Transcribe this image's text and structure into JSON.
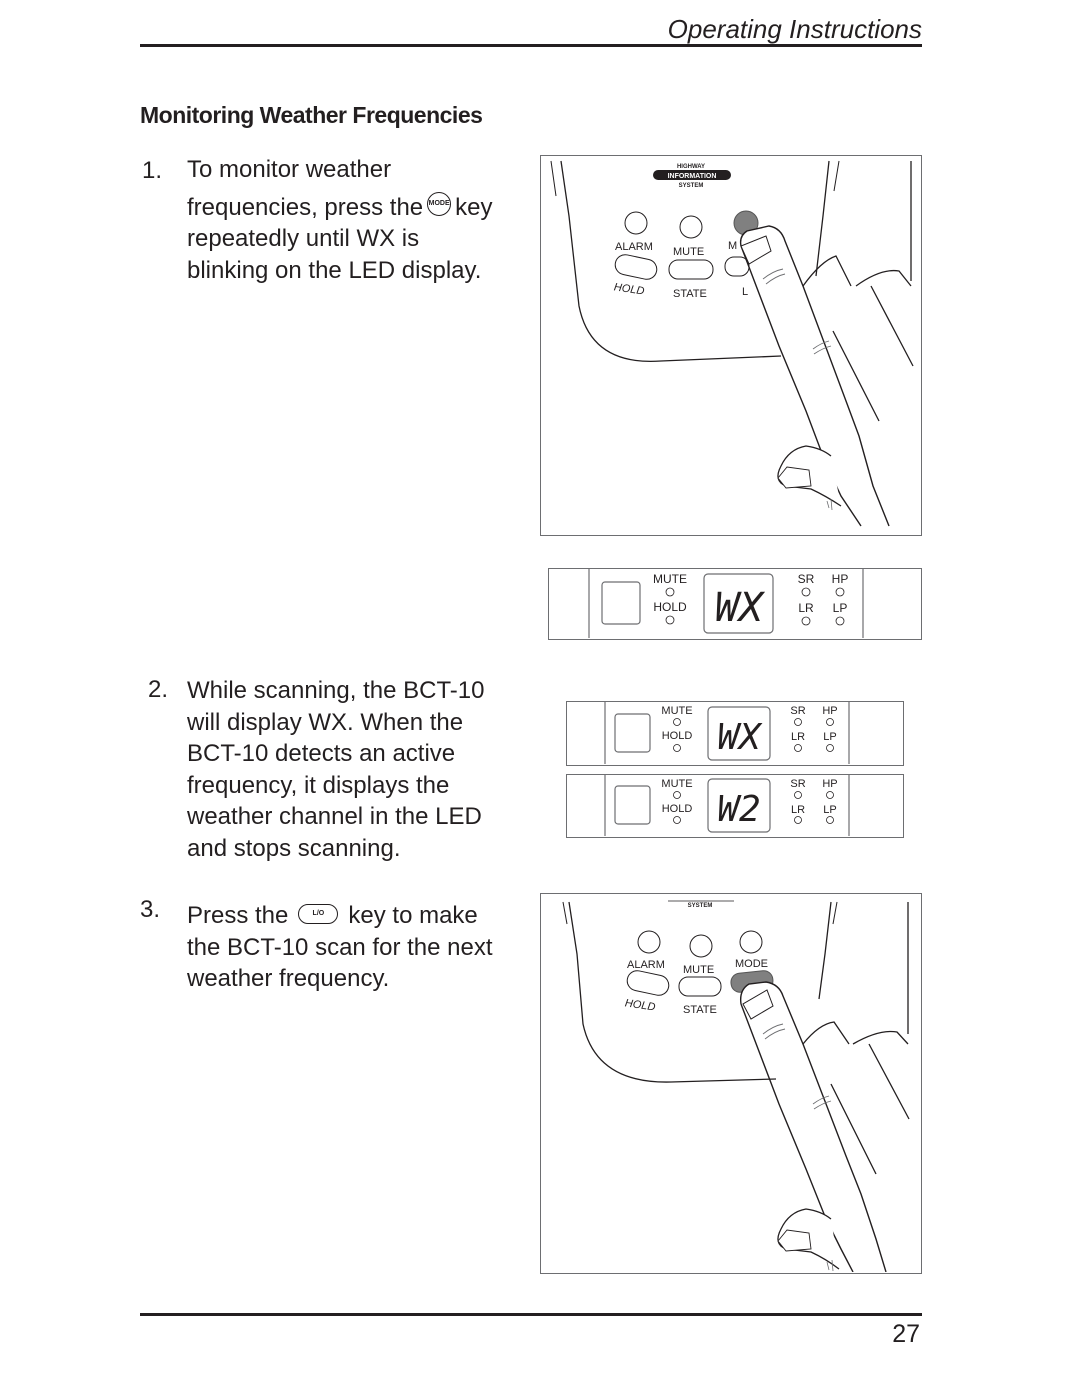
{
  "header": {
    "title": "Operating Instructions"
  },
  "section": {
    "title": "Monitoring Weather Frequencies"
  },
  "steps": [
    {
      "number": "1.",
      "lines": [
        "To monitor weather",
        "frequencies, press the",
        "key",
        "repeatedly until WX is",
        "blinking on the LED display."
      ],
      "key_label": "MODE",
      "key_icon": "mode-key-icon"
    },
    {
      "number": "2.",
      "lines": [
        "While scanning, the BCT-10",
        "will display WX. When the",
        "BCT-10 detects an active",
        "frequency, it displays the",
        "weather channel in the LED",
        "and stops scanning."
      ]
    },
    {
      "number": "3.",
      "lines": [
        "Press the",
        "key to make",
        "the BCT-10 scan for the next",
        "weather frequency."
      ],
      "key_label": "L/O",
      "key_icon": "lockout-key-icon"
    }
  ],
  "illustration_top": {
    "logo": {
      "top": "HIGHWAY",
      "middle": "INFORMATION",
      "bottom": "SYSTEM"
    },
    "buttons": {
      "alarm": "ALARM",
      "mute": "MUTE",
      "mode_partial": "M",
      "hold": "HOLD",
      "state": "STATE",
      "lo_partial": "L"
    },
    "pressed_key": "MODE"
  },
  "displays": [
    {
      "mute": "MUTE",
      "hold": "HOLD",
      "readout": "WX",
      "sr": "SR",
      "hp": "HP",
      "lr": "LR",
      "lp": "LP"
    },
    {
      "mute": "MUTE",
      "hold": "HOLD",
      "readout": "WX",
      "sr": "SR",
      "hp": "HP",
      "lr": "LR",
      "lp": "LP"
    },
    {
      "mute": "MUTE",
      "hold": "HOLD",
      "readout": "W2",
      "sr": "SR",
      "hp": "HP",
      "lr": "LR",
      "lp": "LP"
    }
  ],
  "illustration_bottom": {
    "logo": {
      "bottom": "SYSTEM"
    },
    "buttons": {
      "alarm": "ALARM",
      "mute": "MUTE",
      "mode": "MODE",
      "hold": "HOLD",
      "state": "STATE"
    },
    "pressed_key": "L/O"
  },
  "footer": {
    "page_number": "27"
  },
  "colors": {
    "ink": "#231f20",
    "frame": "#6d6e71",
    "pressed_key": "#808080"
  }
}
